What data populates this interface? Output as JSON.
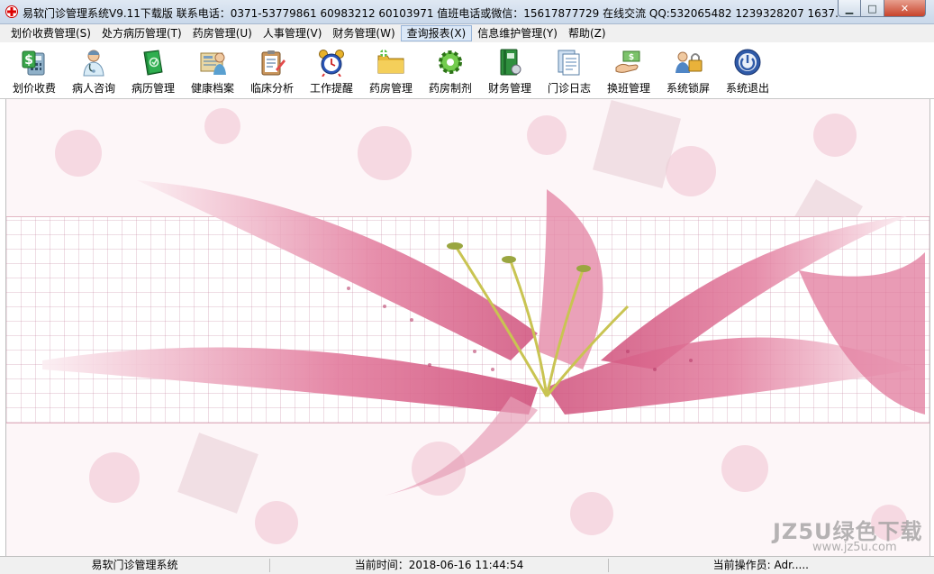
{
  "window": {
    "title": "易软门诊管理系统V9.11下载版   联系电话：0371-53779861 60983212 60103971 值班电话或微信：15617877729  在线交流 QQ:532065482 1239328207 1637...",
    "minimize_glyph": "▁",
    "maximize_glyph": "□",
    "close_glyph": "✕"
  },
  "menu": [
    {
      "label": "划价收费管理(S)"
    },
    {
      "label": "处方病历管理(T)"
    },
    {
      "label": "药房管理(U)"
    },
    {
      "label": "人事管理(V)"
    },
    {
      "label": "财务管理(W)"
    },
    {
      "label": "查询报表(X)"
    },
    {
      "label": "信息维护管理(Y)"
    },
    {
      "label": "帮助(Z)"
    }
  ],
  "toolbar": [
    {
      "label": "划价收费",
      "icon": "cash-calculator-icon"
    },
    {
      "label": "病人咨询",
      "icon": "doctor-icon"
    },
    {
      "label": "病历管理",
      "icon": "medical-record-icon"
    },
    {
      "label": "健康档案",
      "icon": "health-file-icon"
    },
    {
      "label": "临床分析",
      "icon": "clinical-analysis-icon"
    },
    {
      "label": "工作提醒",
      "icon": "alarm-clock-icon"
    },
    {
      "label": "药房管理",
      "icon": "pharmacy-folder-icon"
    },
    {
      "label": "药房制剂",
      "icon": "green-gear-icon"
    },
    {
      "label": "财务管理",
      "icon": "finance-book-icon"
    },
    {
      "label": "门诊日志",
      "icon": "log-document-icon"
    },
    {
      "label": "换班管理",
      "icon": "shift-handover-icon"
    },
    {
      "label": "系统锁屏",
      "icon": "lock-screen-icon"
    },
    {
      "label": "系统退出",
      "icon": "power-exit-icon"
    }
  ],
  "watermark": {
    "text": "JZ5U绿色下载",
    "url": "www.jz5u.com"
  },
  "status": {
    "system_name": "易软门诊管理系统",
    "time": "当前时间：2018-06-16 11:44:54",
    "operator": "当前操作员: Adr....."
  },
  "colors": {
    "accent_pink": "#d9607f",
    "close_red": "#c8432b",
    "menu_active": "#dbe8f7"
  }
}
